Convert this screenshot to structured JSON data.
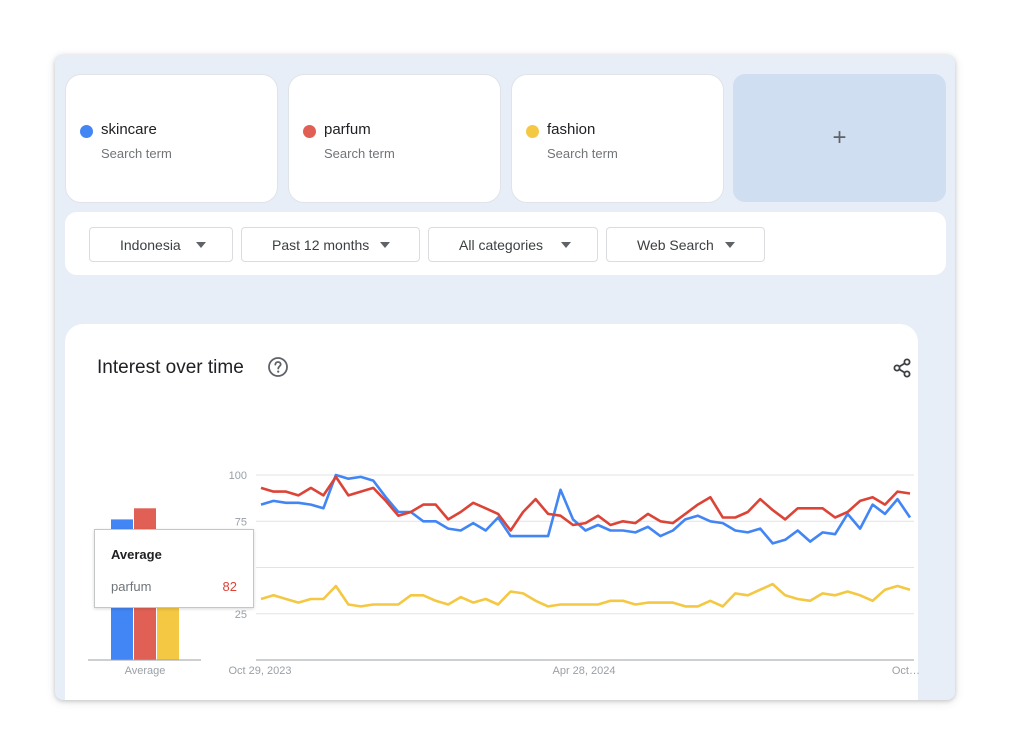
{
  "terms": [
    {
      "name": "skincare",
      "subtitle": "Search term",
      "color": "#4285f4"
    },
    {
      "name": "parfum",
      "subtitle": "Search term",
      "color": "#e06055"
    },
    {
      "name": "fashion",
      "subtitle": "Search term",
      "color": "#f4c842"
    }
  ],
  "add_term": {
    "label": "+"
  },
  "filters": {
    "region": "Indonesia",
    "time_range": "Past 12 months",
    "category": "All categories",
    "search_type": "Web Search"
  },
  "chart": {
    "title": "Interest over time",
    "help_icon": "help-circle-icon",
    "share_icon": "share-icon"
  },
  "tooltip": {
    "title": "Average",
    "term": "parfum",
    "value": "82"
  },
  "chart_data": {
    "type": "line",
    "average_bar": {
      "label": "Average",
      "values": [
        {
          "term": "skincare",
          "value": 76
        },
        {
          "term": "parfum",
          "value": 82
        },
        {
          "term": "fashion",
          "value": 32
        }
      ]
    },
    "y_ticks": [
      "25",
      "50",
      "75",
      "100"
    ],
    "ylim": [
      0,
      100
    ],
    "x_tick_labels": [
      "Oct 29, 2023",
      "Apr 28, 2024",
      "Oct…"
    ],
    "series": [
      {
        "name": "skincare",
        "color": "#4285f4",
        "values": [
          84,
          86,
          85,
          85,
          84,
          82,
          100,
          98,
          99,
          97,
          88,
          80,
          80,
          75,
          75,
          71,
          70,
          74,
          70,
          77,
          67,
          67,
          67,
          67,
          92,
          76,
          70,
          73,
          70,
          70,
          69,
          72,
          67,
          70,
          76,
          78,
          75,
          74,
          70,
          69,
          71,
          63,
          65,
          70,
          64,
          69,
          68,
          79,
          71,
          84,
          79,
          87,
          77
        ]
      },
      {
        "name": "parfum",
        "color": "#db4437",
        "values": [
          93,
          91,
          91,
          89,
          93,
          89,
          99,
          89,
          91,
          93,
          86,
          78,
          80,
          84,
          84,
          76,
          80,
          85,
          82,
          79,
          70,
          80,
          87,
          79,
          78,
          73,
          74,
          78,
          73,
          75,
          74,
          79,
          75,
          74,
          79,
          84,
          88,
          77,
          77,
          80,
          87,
          81,
          76,
          82,
          82,
          82,
          77,
          80,
          86,
          88,
          84,
          91,
          90
        ]
      },
      {
        "name": "fashion",
        "color": "#f4c842",
        "values": [
          33,
          35,
          33,
          31,
          33,
          33,
          40,
          30,
          29,
          30,
          30,
          30,
          35,
          35,
          32,
          30,
          34,
          31,
          33,
          30,
          37,
          36,
          32,
          29,
          30,
          30,
          30,
          30,
          32,
          32,
          30,
          31,
          31,
          31,
          29,
          29,
          32,
          29,
          36,
          35,
          38,
          41,
          35,
          33,
          32,
          36,
          35,
          37,
          35,
          32,
          38,
          40,
          38
        ]
      }
    ]
  }
}
